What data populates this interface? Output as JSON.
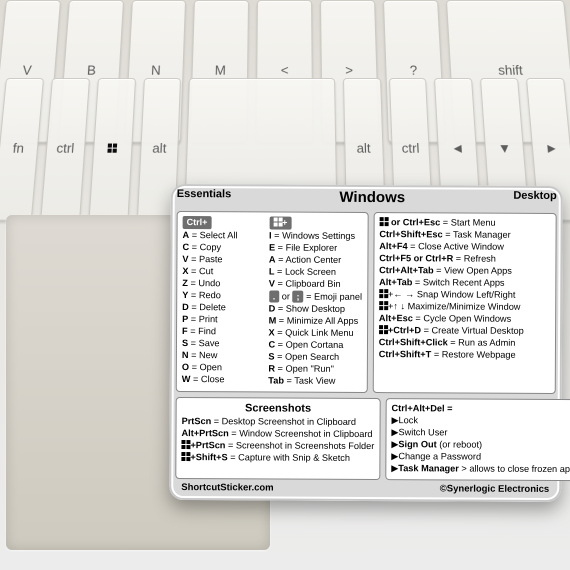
{
  "title": "Windows",
  "labels": {
    "essentials": "Essentials",
    "desktop": "Desktop",
    "screenshots": "Screenshots",
    "cad_header": "Ctrl+Alt+Del ="
  },
  "ctrl_header": "Ctrl+",
  "essentials_col1": [
    {
      "key": "A",
      "desc": "Select All"
    },
    {
      "key": "C",
      "desc": "Copy"
    },
    {
      "key": "V",
      "desc": "Paste"
    },
    {
      "key": "X",
      "desc": "Cut"
    },
    {
      "key": "Z",
      "desc": "Undo"
    },
    {
      "key": "Y",
      "desc": "Redo"
    },
    {
      "key": "D",
      "desc": "Delete"
    },
    {
      "key": "P",
      "desc": "Print"
    },
    {
      "key": "F",
      "desc": "Find"
    },
    {
      "key": "S",
      "desc": "Save"
    },
    {
      "key": "N",
      "desc": "New"
    },
    {
      "key": "O",
      "desc": "Open"
    },
    {
      "key": "W",
      "desc": "Close"
    }
  ],
  "essentials_col2": [
    {
      "key": "I",
      "desc": "Windows Settings"
    },
    {
      "key": "E",
      "desc": "File Explorer"
    },
    {
      "key": "A",
      "desc": "Action Center"
    },
    {
      "key": "L",
      "desc": "Lock Screen"
    },
    {
      "key": "V",
      "desc": "Clipboard Bin"
    },
    {
      "key": ". or ;",
      "desc": "Emoji panel",
      "boxed": true
    },
    {
      "key": "D",
      "desc": "Show Desktop"
    },
    {
      "key": "M",
      "desc": "Minimize All Apps"
    },
    {
      "key": "X",
      "desc": "Quick Link Menu"
    },
    {
      "key": "C",
      "desc": "Open Cortana"
    },
    {
      "key": "S",
      "desc": "Open Search"
    },
    {
      "key": "R",
      "desc": "Open \"Run\""
    },
    {
      "key": "Tab",
      "desc": "Task View"
    }
  ],
  "desktop_rows": [
    {
      "combo": "[WIN] or Ctrl+Esc",
      "desc": "Start Menu"
    },
    {
      "combo": "Ctrl+Shift+Esc",
      "desc": "Task Manager"
    },
    {
      "combo": "Alt+F4",
      "desc": "Close Active Window"
    },
    {
      "combo": "Ctrl+F5 or Ctrl+R",
      "desc": "Refresh"
    },
    {
      "combo": "Ctrl+Alt+Tab",
      "desc": "View Open Apps"
    },
    {
      "combo": "Alt+Tab",
      "desc": "Switch Recent Apps"
    },
    {
      "combo": "[WIN]+← → Snap Window Left/Right",
      "desc": "",
      "raw": true
    },
    {
      "combo": "[WIN]+↑ ↓ Maximize/Minimize Window",
      "desc": "",
      "raw": true
    },
    {
      "combo": "Alt+Esc",
      "desc": "Cycle Open Windows"
    },
    {
      "combo": "[WIN]+Ctrl+D",
      "desc": "Create Virtual Desktop"
    },
    {
      "combo": "Ctrl+Shift+Click",
      "desc": "Run as Admin"
    },
    {
      "combo": "Ctrl+Shift+T",
      "desc": "Restore Webpage"
    }
  ],
  "screenshots_rows": [
    {
      "combo": "PrtScn",
      "desc": "Desktop Screenshot in Clipboard"
    },
    {
      "combo": "Alt+PrtScn",
      "desc": "Window Screenshot in Clipboard"
    },
    {
      "combo": "[WIN]+PrtScn",
      "desc": "Screenshot in Screenshots Folder"
    },
    {
      "combo": "[WIN]+Shift+S",
      "desc": "Capture with Snip & Sketch"
    }
  ],
  "cad_rows": [
    "▶Lock",
    "▶Switch User",
    "▶Sign Out (or reboot)",
    "▶Change a Password",
    "▶Task Manager > allows to close frozen apps"
  ],
  "footer": {
    "left": "ShortcutSticker.com",
    "right": "©Synerlogic Electronics"
  }
}
